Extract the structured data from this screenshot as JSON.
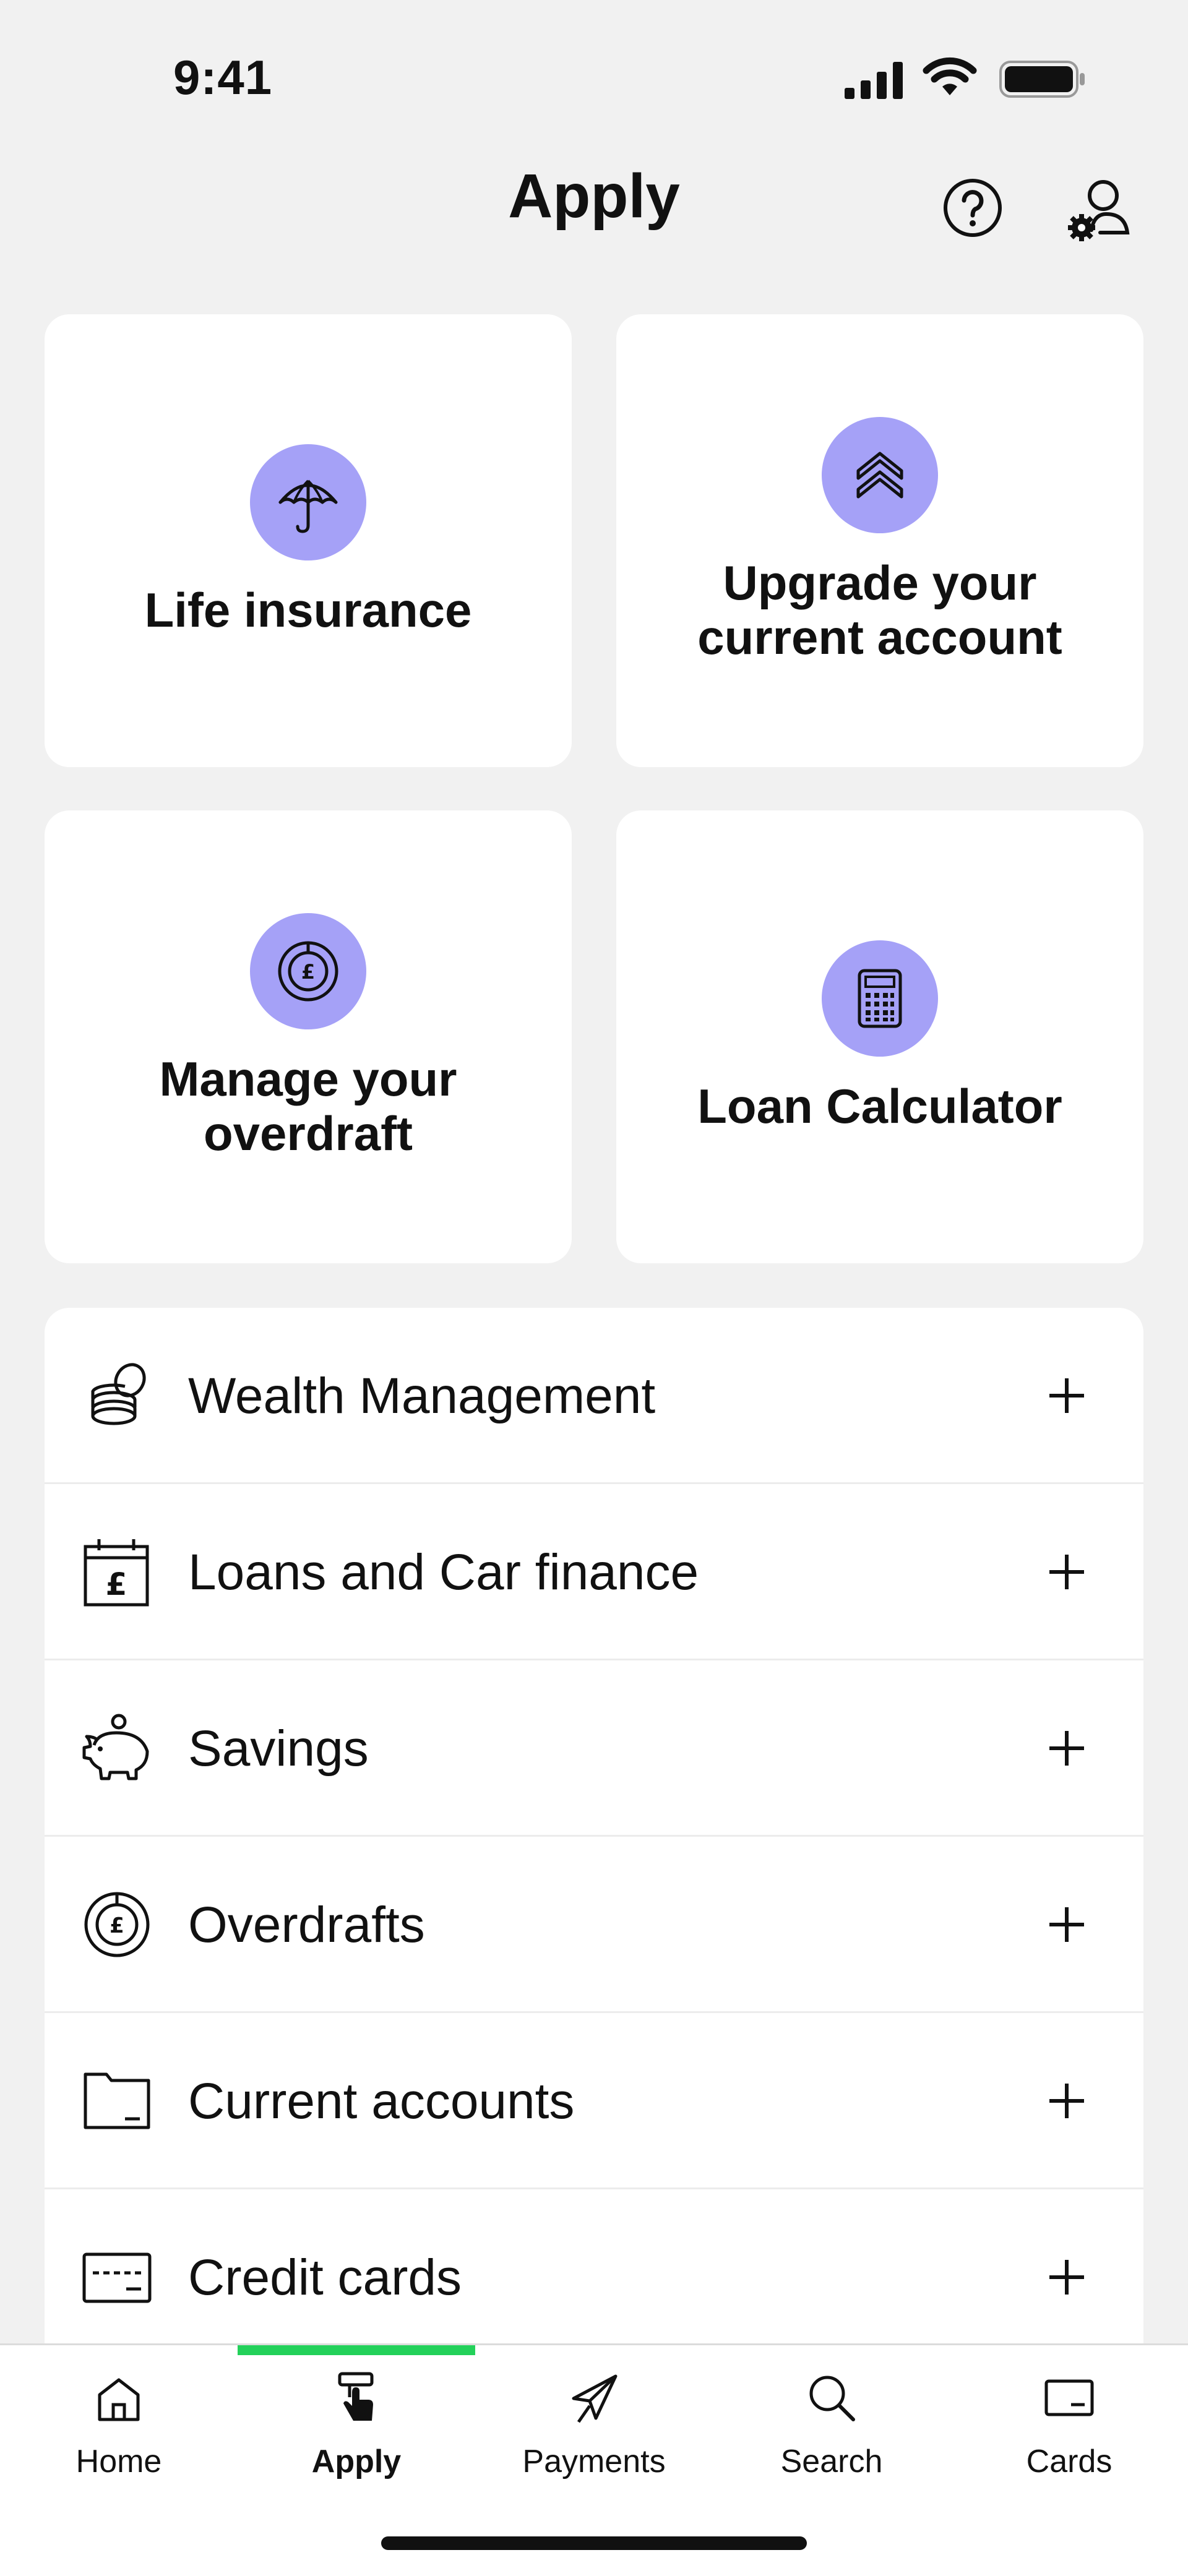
{
  "status_bar": {
    "time": "9:41"
  },
  "header": {
    "title": "Apply"
  },
  "tiles": [
    {
      "label": "Life insurance",
      "icon": "umbrella-icon"
    },
    {
      "label": "Upgrade your\ncurrent account",
      "icon": "upgrade-chevrons-icon"
    },
    {
      "label": "Manage your\noverdraft",
      "icon": "overdraft-icon"
    },
    {
      "label": "Loan Calculator",
      "icon": "calculator-icon"
    }
  ],
  "list": [
    {
      "label": "Wealth Management",
      "icon": "coins-icon"
    },
    {
      "label": "Loans and Car finance",
      "icon": "loan-calendar-icon"
    },
    {
      "label": "Savings",
      "icon": "piggy-bank-icon"
    },
    {
      "label": "Overdrafts",
      "icon": "overdraft-icon"
    },
    {
      "label": "Current accounts",
      "icon": "folder-icon"
    },
    {
      "label": "Credit cards",
      "icon": "credit-card-icon"
    }
  ],
  "nav": [
    {
      "label": "Home",
      "icon": "home-icon"
    },
    {
      "label": "Apply",
      "icon": "apply-icon",
      "active": true
    },
    {
      "label": "Payments",
      "icon": "payments-icon"
    },
    {
      "label": "Search",
      "icon": "search-icon"
    },
    {
      "label": "Cards",
      "icon": "cards-icon"
    }
  ],
  "colors": {
    "accent_circle": "#a5a1f7",
    "active_indicator": "#23d15a",
    "background": "#f1f1f1"
  }
}
